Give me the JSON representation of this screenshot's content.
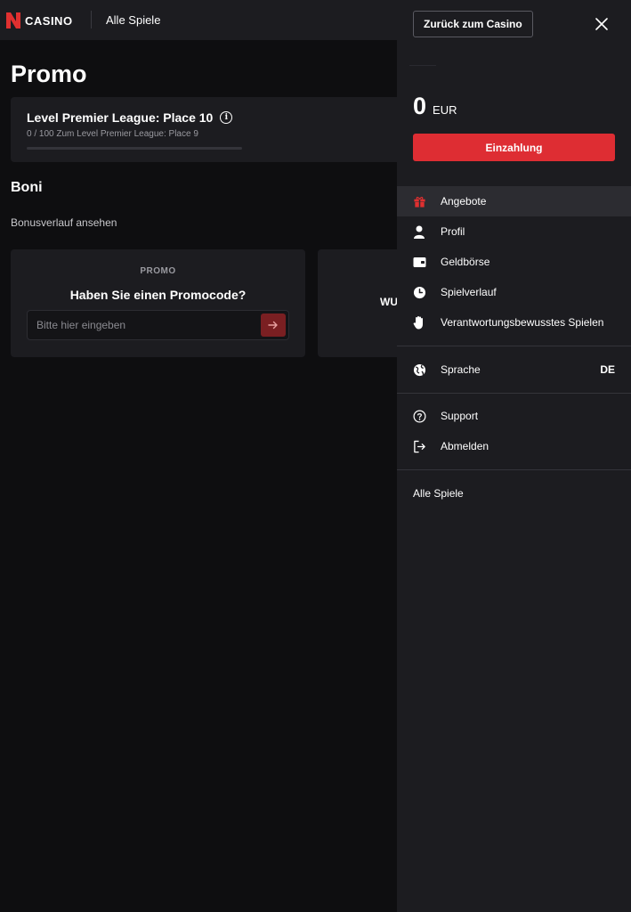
{
  "header": {
    "logo_text": "CASINO",
    "nav_link": "Alle Spiele"
  },
  "main": {
    "page_title": "Promo",
    "level": {
      "title": "Level Premier League: Place 10",
      "subtitle": "0 / 100 Zum Level Premier League: Place 9",
      "progress_percent": 0
    },
    "bonus_section_title": "Boni",
    "bonus_history_link": "Bonusverlauf ansehen",
    "promo_card": {
      "label": "PROMO",
      "heading": "Haben Sie einen Promocode?",
      "input_placeholder": "Bitte hier eingeben",
      "input_value": ""
    },
    "second_card_text": "WU"
  },
  "drawer": {
    "back_button": "Zurück zum Casino",
    "balance_amount": "0",
    "balance_currency": "EUR",
    "deposit_button": "Einzahlung",
    "menu": [
      {
        "label": "Angebote",
        "icon": "gift-icon",
        "active": true
      },
      {
        "label": "Profil",
        "icon": "user-icon",
        "active": false
      },
      {
        "label": "Geldbörse",
        "icon": "wallet-icon",
        "active": false
      },
      {
        "label": "Spielverlauf",
        "icon": "clock-icon",
        "active": false
      },
      {
        "label": "Verantwortungsbewusstes Spielen",
        "icon": "hand-icon",
        "active": false
      }
    ],
    "language": {
      "label": "Sprache",
      "value": "DE",
      "icon": "globe-icon"
    },
    "support": {
      "label": "Support",
      "icon": "help-circle-icon"
    },
    "logout": {
      "label": "Abmelden",
      "icon": "logout-icon"
    },
    "footer_link": "Alle Spiele"
  },
  "colors": {
    "background": "#0e0e10",
    "surface": "#1c1c20",
    "accent": "#de2d33"
  }
}
